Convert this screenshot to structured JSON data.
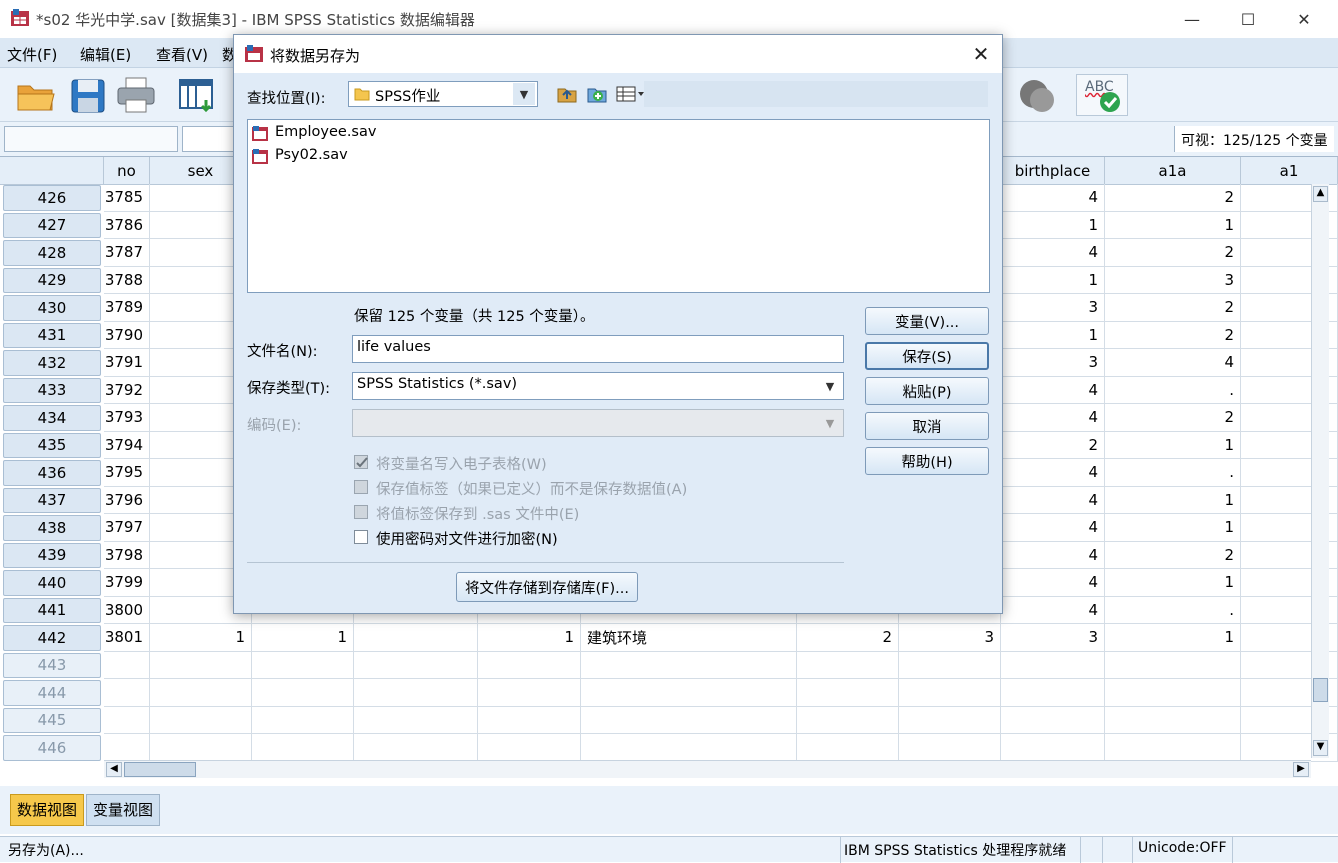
{
  "window": {
    "title": "*s02 华光中学.sav [数据集3] - IBM SPSS Statistics 数据编辑器",
    "minimize": "—",
    "maximize": "☐",
    "close": "✕"
  },
  "menu": [
    {
      "label": "文件(F)"
    },
    {
      "label": "编辑(E)"
    },
    {
      "label": "查看(V)"
    },
    {
      "label": "数"
    }
  ],
  "toolbar": {
    "icons": [
      "open-folder-icon",
      "save-icon",
      "print-icon",
      "dialog-recall-icon",
      "weight-icon",
      "spell-check-icon"
    ],
    "spell_label": "ABC"
  },
  "cellbar": {
    "visible": "可视：125/125 个变量"
  },
  "grid": {
    "columns": [
      {
        "key": "rownum",
        "label": ""
      },
      {
        "key": "no",
        "label": "no"
      },
      {
        "key": "sex",
        "label": "sex"
      },
      {
        "key": "c3",
        "label": ""
      },
      {
        "key": "c4",
        "label": ""
      },
      {
        "key": "c5",
        "label": ""
      },
      {
        "key": "c6",
        "label": ""
      },
      {
        "key": "c7",
        "label": ""
      },
      {
        "key": "c8",
        "label": ""
      },
      {
        "key": "birthplace",
        "label": "birthplace"
      },
      {
        "key": "a1a",
        "label": "a1a"
      },
      {
        "key": "a1",
        "label": "a1"
      }
    ],
    "rows": [
      {
        "n": "426",
        "no": "3785",
        "birthplace": "4",
        "a1a": "2"
      },
      {
        "n": "427",
        "no": "3786",
        "birthplace": "1",
        "a1a": "1"
      },
      {
        "n": "428",
        "no": "3787",
        "birthplace": "4",
        "a1a": "2"
      },
      {
        "n": "429",
        "no": "3788",
        "birthplace": "1",
        "a1a": "3"
      },
      {
        "n": "430",
        "no": "3789",
        "birthplace": "3",
        "a1a": "2"
      },
      {
        "n": "431",
        "no": "3790",
        "birthplace": "1",
        "a1a": "2"
      },
      {
        "n": "432",
        "no": "3791",
        "birthplace": "3",
        "a1a": "4"
      },
      {
        "n": "433",
        "no": "3792",
        "birthplace": "4",
        "a1a": "."
      },
      {
        "n": "434",
        "no": "3793",
        "birthplace": "4",
        "a1a": "2"
      },
      {
        "n": "435",
        "no": "3794",
        "birthplace": "2",
        "a1a": "1"
      },
      {
        "n": "436",
        "no": "3795",
        "birthplace": "4",
        "a1a": "."
      },
      {
        "n": "437",
        "no": "3796",
        "birthplace": "4",
        "a1a": "1"
      },
      {
        "n": "438",
        "no": "3797",
        "birthplace": "4",
        "a1a": "1"
      },
      {
        "n": "439",
        "no": "3798",
        "birthplace": "4",
        "a1a": "2"
      },
      {
        "n": "440",
        "no": "3799",
        "birthplace": "4",
        "a1a": "1"
      },
      {
        "n": "441",
        "no": "3800",
        "birthplace": "4",
        "a1a": "."
      },
      {
        "n": "442",
        "no": "3801",
        "sex": "1",
        "c3": "1",
        "c5": "1",
        "c6": "建筑环境",
        "c7": "2",
        "c8": "3",
        "birthplace": "3",
        "a1a": "1"
      }
    ],
    "empty_rows": [
      "443",
      "444",
      "445",
      "446"
    ]
  },
  "tabs": {
    "data_view": "数据视图",
    "variable_view": "变量视图"
  },
  "status": {
    "left": "另存为(A)...",
    "processor": "IBM SPSS Statistics 处理程序就绪",
    "unicode": "Unicode:OFF"
  },
  "dialog": {
    "title": "将数据另存为",
    "close": "✕",
    "look_in_label": "查找位置(I):",
    "look_in_value": "SPSS作业",
    "files": [
      {
        "name": "Employee.sav"
      },
      {
        "name": "Psy02.sav"
      }
    ],
    "keep_info": "保留 125 个变量（共 125 个变量）。",
    "filename_label": "文件名(N):",
    "filename_value": "life values",
    "type_label": "保存类型(T):",
    "type_value": "SPSS Statistics (*.sav)",
    "encoding_label": "编码(E):",
    "checkboxes": [
      {
        "label": "将变量名写入电子表格(W)",
        "checked": true,
        "enabled": false
      },
      {
        "label": "保存值标签（如果已定义）而不是保存数据值(A)",
        "checked": false,
        "enabled": false
      },
      {
        "label": "将值标签保存到 .sas 文件中(E)",
        "checked": false,
        "enabled": false
      },
      {
        "label": "使用密码对文件进行加密(N)",
        "checked": false,
        "enabled": true
      }
    ],
    "buttons": {
      "variables": "变量(V)...",
      "save": "保存(S)",
      "paste": "粘贴(P)",
      "cancel": "取消",
      "help": "帮助(H)",
      "repository": "将文件存储到存储库(F)..."
    }
  }
}
